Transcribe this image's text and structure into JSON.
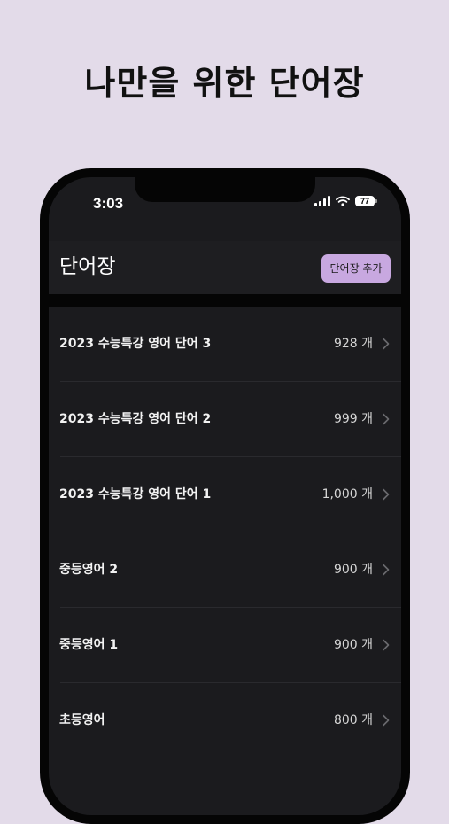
{
  "headline": "나만을 위한 단어장",
  "status_bar": {
    "time": "3:03",
    "battery_level": "77",
    "icons": [
      "cellular-signal-icon",
      "wifi-icon",
      "battery-icon"
    ]
  },
  "nav": {
    "title": "단어장",
    "add_button_label": "단어장 추가"
  },
  "vocab_lists": [
    {
      "name": "2023 수능특강 영어 단어 3",
      "count": "928 개"
    },
    {
      "name": "2023 수능특강 영어 단어 2",
      "count": "999 개"
    },
    {
      "name": "2023 수능특강 영어 단어 1",
      "count": "1,000 개"
    },
    {
      "name": "중등영어 2",
      "count": "900 개"
    },
    {
      "name": "중등영어 1",
      "count": "900 개"
    },
    {
      "name": "초등영어",
      "count": "800 개"
    }
  ],
  "colors": {
    "page_background": "#e3dbe9",
    "screen_background": "#1b1b1e",
    "accent_button": "#c8a8e0"
  }
}
